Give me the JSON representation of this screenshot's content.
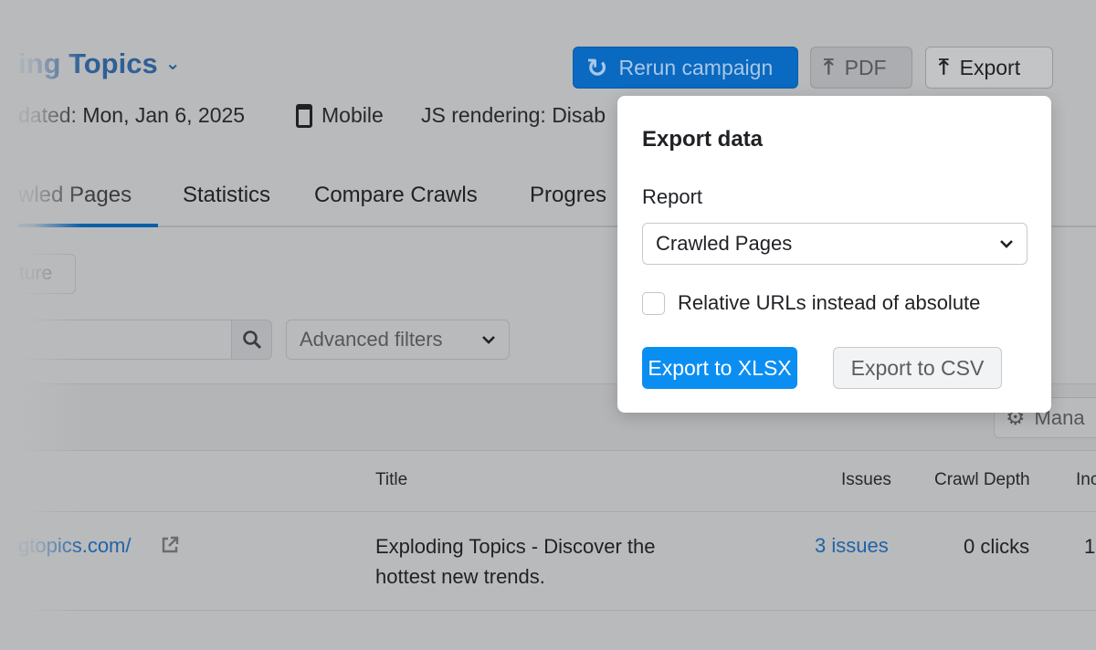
{
  "header": {
    "title": "ing Topics",
    "updated": "dated: Mon, Jan 6, 2025",
    "device": "Mobile",
    "js_rendering": "JS rendering: Disab"
  },
  "toolbar": {
    "rerun": "Rerun campaign",
    "pdf": "PDF",
    "export": "Export"
  },
  "tabs": [
    {
      "label": "wled Pages",
      "active": true
    },
    {
      "label": "Statistics"
    },
    {
      "label": "Compare Crawls"
    },
    {
      "label": "Progres"
    }
  ],
  "filters": {
    "structure_button": "ture",
    "search_placeholder": "",
    "advanced_filters": "Advanced filters",
    "manage": "Mana"
  },
  "table": {
    "columns": [
      "Title",
      "Issues",
      "Crawl Depth",
      "Inc"
    ],
    "rows": [
      {
        "url": "gtopics.com/",
        "title_line1": "Exploding Topics - Discover the",
        "title_line2": "hottest new trends.",
        "issues": "3 issues",
        "crawl_depth": "0 clicks",
        "inc": "1"
      }
    ]
  },
  "export_popup": {
    "title": "Export data",
    "report_label": "Report",
    "report_value": "Crawled Pages",
    "checkbox_label": "Relative URLs instead of absolute",
    "checkbox_checked": false,
    "xlsx_button": "Export to XLSX",
    "csv_button": "Export to CSV"
  },
  "colors": {
    "primary": "#0b8ef2",
    "rerun": "#0a69c0",
    "link": "#1f63a8"
  }
}
